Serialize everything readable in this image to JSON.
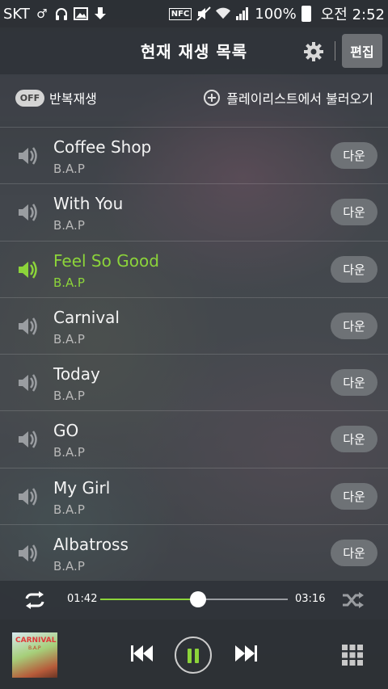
{
  "statusbar": {
    "carrier": "SKT",
    "nfc": "NFC",
    "battery": "100%",
    "time": "오전 2:52"
  },
  "header": {
    "title": "현재 재생 목록",
    "edit_label": "편집"
  },
  "options": {
    "repeat_state": "OFF",
    "repeat_label": "반복재생",
    "load_playlist_label": "플레이리스트에서 불러오기"
  },
  "tracks": [
    {
      "title": "Coffee Shop",
      "artist": "B.A.P",
      "download": "다운",
      "playing": false
    },
    {
      "title": "With You",
      "artist": "B.A.P",
      "download": "다운",
      "playing": false
    },
    {
      "title": "Feel So Good",
      "artist": "B.A.P",
      "download": "다운",
      "playing": true
    },
    {
      "title": "Carnival",
      "artist": "B.A.P",
      "download": "다운",
      "playing": false
    },
    {
      "title": "Today",
      "artist": "B.A.P",
      "download": "다운",
      "playing": false
    },
    {
      "title": "GO",
      "artist": "B.A.P",
      "download": "다운",
      "playing": false
    },
    {
      "title": "My Girl",
      "artist": "B.A.P",
      "download": "다운",
      "playing": false
    },
    {
      "title": "Albatross",
      "artist": "B.A.P",
      "download": "다운",
      "playing": false
    }
  ],
  "player": {
    "current_time": "01:42",
    "total_time": "03:16",
    "progress_fraction": 0.52,
    "album_text": "CARNIVAL",
    "album_artist": "B.A.P"
  },
  "colors": {
    "accent": "#8cd43a",
    "button_bg": "#6e7276"
  },
  "icons": {
    "track_idle": "speaker-icon",
    "track_playing": "speaker-active-icon"
  }
}
